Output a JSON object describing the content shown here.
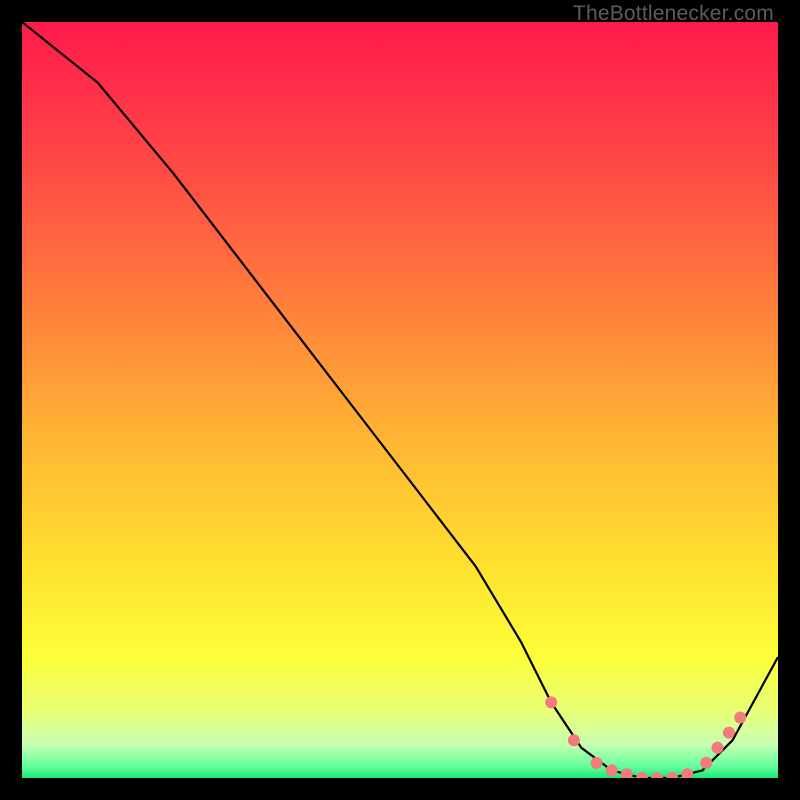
{
  "watermark": "TheBottlenecker.com",
  "chart_data": {
    "type": "line",
    "title": "",
    "xlabel": "",
    "ylabel": "",
    "xlim": [
      0,
      100
    ],
    "ylim": [
      0,
      100
    ],
    "background_gradient": {
      "stops": [
        {
          "offset": 0.0,
          "color": "#ff1a4c"
        },
        {
          "offset": 0.18,
          "color": "#ff4646"
        },
        {
          "offset": 0.36,
          "color": "#ff7a3c"
        },
        {
          "offset": 0.55,
          "color": "#ffb534"
        },
        {
          "offset": 0.72,
          "color": "#ffe12e"
        },
        {
          "offset": 0.84,
          "color": "#fdff3a"
        },
        {
          "offset": 0.91,
          "color": "#e8ff74"
        },
        {
          "offset": 0.955,
          "color": "#c9ffb0"
        },
        {
          "offset": 0.985,
          "color": "#62ff9d"
        },
        {
          "offset": 1.0,
          "color": "#19e676"
        }
      ]
    },
    "series": [
      {
        "name": "bottleneck-curve",
        "x": [
          0,
          10,
          20,
          30,
          40,
          50,
          60,
          66,
          70,
          74,
          78,
          82,
          86,
          90,
          94,
          100
        ],
        "y": [
          100,
          92,
          80,
          67,
          54,
          41,
          28,
          18,
          10,
          4,
          1,
          0,
          0,
          1,
          5,
          16
        ]
      }
    ],
    "markers": {
      "name": "optimal-range-dots",
      "x": [
        70,
        73,
        76,
        78,
        80,
        82,
        84,
        86,
        88,
        90.5,
        92,
        93.5,
        95
      ],
      "y": [
        10,
        5,
        2,
        1,
        0.5,
        0,
        0,
        0,
        0.5,
        2,
        4,
        6,
        8
      ],
      "color": "#f37a7d",
      "radius": 6
    }
  }
}
